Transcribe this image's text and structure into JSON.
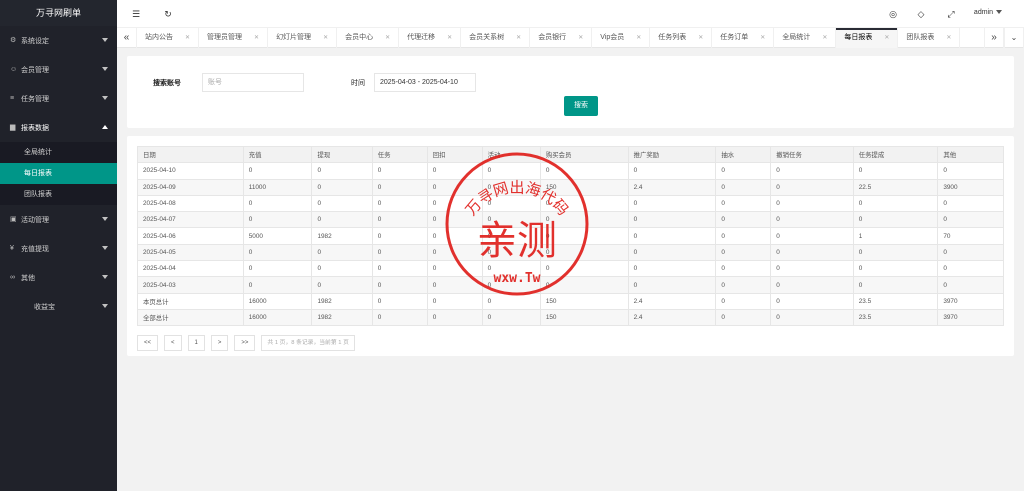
{
  "app": {
    "title": "万寻网刷单"
  },
  "sidebar": {
    "items": [
      {
        "label": "系统设定",
        "icon": "gear-icon",
        "glyph": "⚙"
      },
      {
        "label": "会员管理",
        "icon": "user-icon",
        "glyph": "☺"
      },
      {
        "label": "任务管理",
        "icon": "list-icon",
        "glyph": "≡"
      },
      {
        "label": "报表数据",
        "icon": "report-icon",
        "glyph": "▆"
      },
      {
        "label": "活动管理",
        "icon": "gift-icon",
        "glyph": "▣"
      },
      {
        "label": "充值提现",
        "icon": "money-icon",
        "glyph": "¥"
      },
      {
        "label": "其他",
        "icon": "link-icon",
        "glyph": "∞"
      },
      {
        "label": "收益宝",
        "icon": "",
        "glyph": ""
      }
    ],
    "report_sub": [
      {
        "label": "全局统计"
      },
      {
        "label": "每日报表"
      },
      {
        "label": "团队报表"
      }
    ]
  },
  "header": {
    "user": "admin"
  },
  "tabs": [
    {
      "label": "站内公告"
    },
    {
      "label": "管理员管理"
    },
    {
      "label": "幻灯片管理"
    },
    {
      "label": "会员中心"
    },
    {
      "label": "代理迁移"
    },
    {
      "label": "会员关系树"
    },
    {
      "label": "会员银行"
    },
    {
      "label": "Vip会员"
    },
    {
      "label": "任务列表"
    },
    {
      "label": "任务订单"
    },
    {
      "label": "全局统计"
    },
    {
      "label": "每日报表"
    },
    {
      "label": "团队报表"
    }
  ],
  "search": {
    "account_label": "搜索账号",
    "account_placeholder": "账号",
    "time_label": "时间",
    "time_value": "2025-04-03 - 2025-04-10",
    "button": "搜索"
  },
  "table": {
    "columns": [
      "日期",
      "充值",
      "提现",
      "任务",
      "回扣",
      "活动",
      "购买会员",
      "推广奖励",
      "抽水",
      "撤销任务",
      "任务提成",
      "其他"
    ],
    "rows": [
      [
        "2025-04-10",
        "0",
        "0",
        "0",
        "0",
        "0",
        "0",
        "0",
        "0",
        "0",
        "0",
        "0"
      ],
      [
        "2025-04-09",
        "11000",
        "0",
        "0",
        "0",
        "0",
        "150",
        "2.4",
        "0",
        "0",
        "22.5",
        "3900"
      ],
      [
        "2025-04-08",
        "0",
        "0",
        "0",
        "0",
        "0",
        "0",
        "0",
        "0",
        "0",
        "0",
        "0"
      ],
      [
        "2025-04-07",
        "0",
        "0",
        "0",
        "0",
        "0",
        "0",
        "0",
        "0",
        "0",
        "0",
        "0"
      ],
      [
        "2025-04-06",
        "5000",
        "1982",
        "0",
        "0",
        "0",
        "0",
        "0",
        "0",
        "0",
        "1",
        "70"
      ],
      [
        "2025-04-05",
        "0",
        "0",
        "0",
        "0",
        "0",
        "0",
        "0",
        "0",
        "0",
        "0",
        "0"
      ],
      [
        "2025-04-04",
        "0",
        "0",
        "0",
        "0",
        "0",
        "0",
        "0",
        "0",
        "0",
        "0",
        "0"
      ],
      [
        "2025-04-03",
        "0",
        "0",
        "0",
        "0",
        "0",
        "0",
        "0",
        "0",
        "0",
        "0",
        "0"
      ],
      [
        "本页总计",
        "16000",
        "1982",
        "0",
        "0",
        "0",
        "150",
        "2.4",
        "0",
        "0",
        "23.5",
        "3970"
      ],
      [
        "全部总计",
        "16000",
        "1982",
        "0",
        "0",
        "0",
        "150",
        "2.4",
        "0",
        "0",
        "23.5",
        "3970"
      ]
    ]
  },
  "pager": {
    "first": "<<",
    "prev": "<",
    "page": "1",
    "next": ">",
    "last": ">>",
    "info": "共 1 页，8 条记录，当前第 1 页"
  },
  "stamp": {
    "top_text": "万寻网出海代码",
    "main_text": "亲测",
    "bottom_text": "wxw.Tw",
    "color": "#e0201c"
  }
}
